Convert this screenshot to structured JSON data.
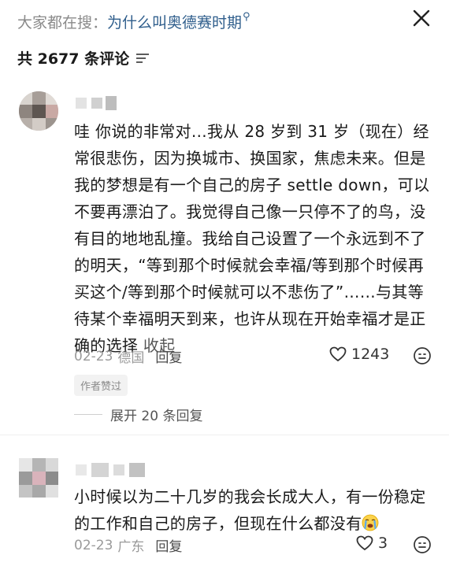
{
  "header": {
    "search_prefix": "大家都在搜：",
    "search_query": "为什么叫奥德赛时期",
    "close_icon": "close-icon"
  },
  "comment_count_label": "共 2677 条评论",
  "comments": [
    {
      "text": "哇 你说的非常对…我从 28 岁到 31 岁（现在）经常很悲伤，因为换城市、换国家，焦虑未来。但是我的梦想是有一个自己的房子 settle down，可以不要再漂泊了。我觉得自己像一只停不了的鸟，没有目的地地乱撞。我给自己设置了一个永远到不了的明天，“等到那个时候就会幸福/等到那个时候再买这个/等到那个时候就可以不悲伤了”……与其等待某个幸福明天到来，也许从现在开始幸福才是正确的选择",
      "collapse_label": "收起",
      "date": "02-23",
      "location": "德国",
      "reply_label": "回复",
      "likes": "1243",
      "badge": "作者赞过",
      "expand_label": "展开 20 条回复"
    },
    {
      "text": "小时候以为二十几岁的我会长成大人，有一份稳定的工作和自己的房子，但现在什么都没有",
      "date": "02-23",
      "location": "广东",
      "reply_label": "回复",
      "likes": "3"
    }
  ]
}
